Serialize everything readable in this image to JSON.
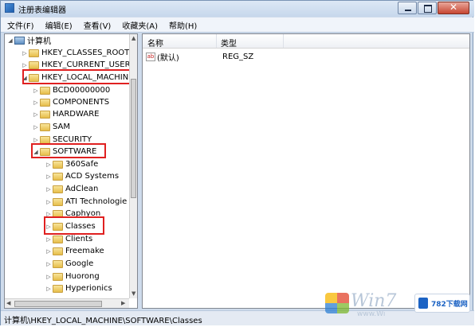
{
  "window": {
    "title": "注册表编辑器"
  },
  "menu": [
    "文件(F)",
    "编辑(E)",
    "查看(V)",
    "收藏夹(A)",
    "帮助(H)"
  ],
  "tree": {
    "root": "计算机",
    "items": [
      {
        "label": "HKEY_CLASSES_ROOT"
      },
      {
        "label": "HKEY_CURRENT_USER"
      },
      {
        "label": "HKEY_LOCAL_MACHINE"
      },
      {
        "label": "BCD00000000"
      },
      {
        "label": "COMPONENTS"
      },
      {
        "label": "HARDWARE"
      },
      {
        "label": "SAM"
      },
      {
        "label": "SECURITY"
      },
      {
        "label": "SOFTWARE"
      },
      {
        "label": "360Safe"
      },
      {
        "label": "ACD Systems"
      },
      {
        "label": "AdClean"
      },
      {
        "label": "ATI Technologie"
      },
      {
        "label": "Caphyon"
      },
      {
        "label": "Classes"
      },
      {
        "label": "Clients"
      },
      {
        "label": "Freemake"
      },
      {
        "label": "Google"
      },
      {
        "label": "Huorong"
      },
      {
        "label": "Hyperionics"
      }
    ]
  },
  "list": {
    "columns": [
      "名称",
      "类型"
    ],
    "rows": [
      {
        "name": "(默认)",
        "type": "REG_SZ"
      }
    ]
  },
  "status": {
    "path": "计算机\\HKEY_LOCAL_MACHINE\\SOFTWARE\\Classes"
  },
  "watermark": {
    "text": "Win7",
    "sub": "www.Wi",
    "logo_text": "782下载网"
  },
  "colors": {
    "highlight_box": "#e02020"
  }
}
